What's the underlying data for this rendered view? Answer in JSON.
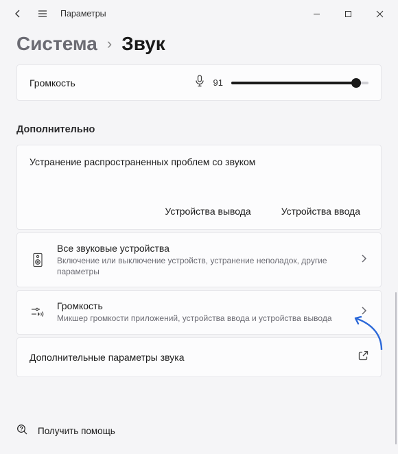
{
  "titlebar": {
    "title": "Параметры"
  },
  "breadcrumb": {
    "system": "Система",
    "separator": "›",
    "sound": "Звук"
  },
  "volume": {
    "label": "Громкость",
    "value": "91",
    "percent": 91
  },
  "section_header": "Дополнительно",
  "troubleshoot": {
    "title": "Устранение распространенных проблем со звуком",
    "output": "Устройства вывода",
    "input": "Устройства ввода"
  },
  "rows": {
    "all_devices": {
      "title": "Все звуковые устройства",
      "sub": "Включение или выключение устройств, устранение неполадок, другие параметры"
    },
    "mixer": {
      "title": "Громкость",
      "sub": "Микшер громкости приложений, устройства ввода и устройства вывода"
    },
    "more": {
      "title": "Дополнительные параметры звука"
    }
  },
  "help": {
    "label": "Получить помощь"
  }
}
